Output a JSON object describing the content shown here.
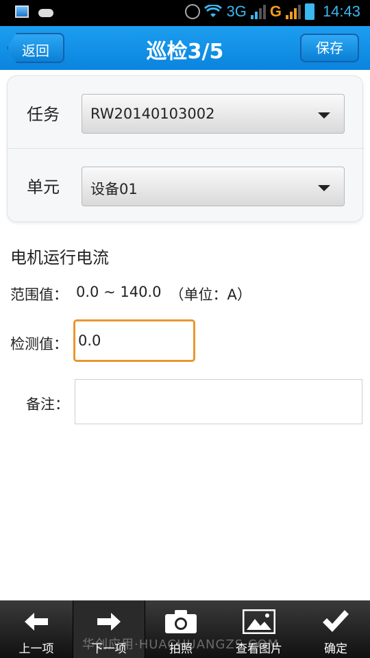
{
  "status_bar": {
    "network_1": "3G",
    "network_2": "G",
    "time": "14:43"
  },
  "header": {
    "back_label": "返回",
    "title": "巡检3/5",
    "save_label": "保存"
  },
  "selectors": [
    {
      "label": "任务",
      "value": "RW20140103002"
    },
    {
      "label": "单元",
      "value": "设备01"
    }
  ],
  "inspection": {
    "item_title": "电机运行电流",
    "range_label": "范围值：",
    "range_value": "0.0 ~ 140.0",
    "unit_text": "（单位：A）",
    "measured_label": "检测值：",
    "measured_value": "0.0",
    "note_label": "备注：",
    "note_value": ""
  },
  "toolbar": {
    "prev_label": "上一项",
    "next_label": "下一项",
    "photo_label": "拍照",
    "view_label": "查看图片",
    "confirm_label": "确定"
  },
  "watermark": "华创应用·HUACHUANGZS.COM",
  "colors": {
    "header_blue": "#0a84de",
    "status_accent": "#3ab8f0",
    "focus_orange": "#e8962e"
  }
}
